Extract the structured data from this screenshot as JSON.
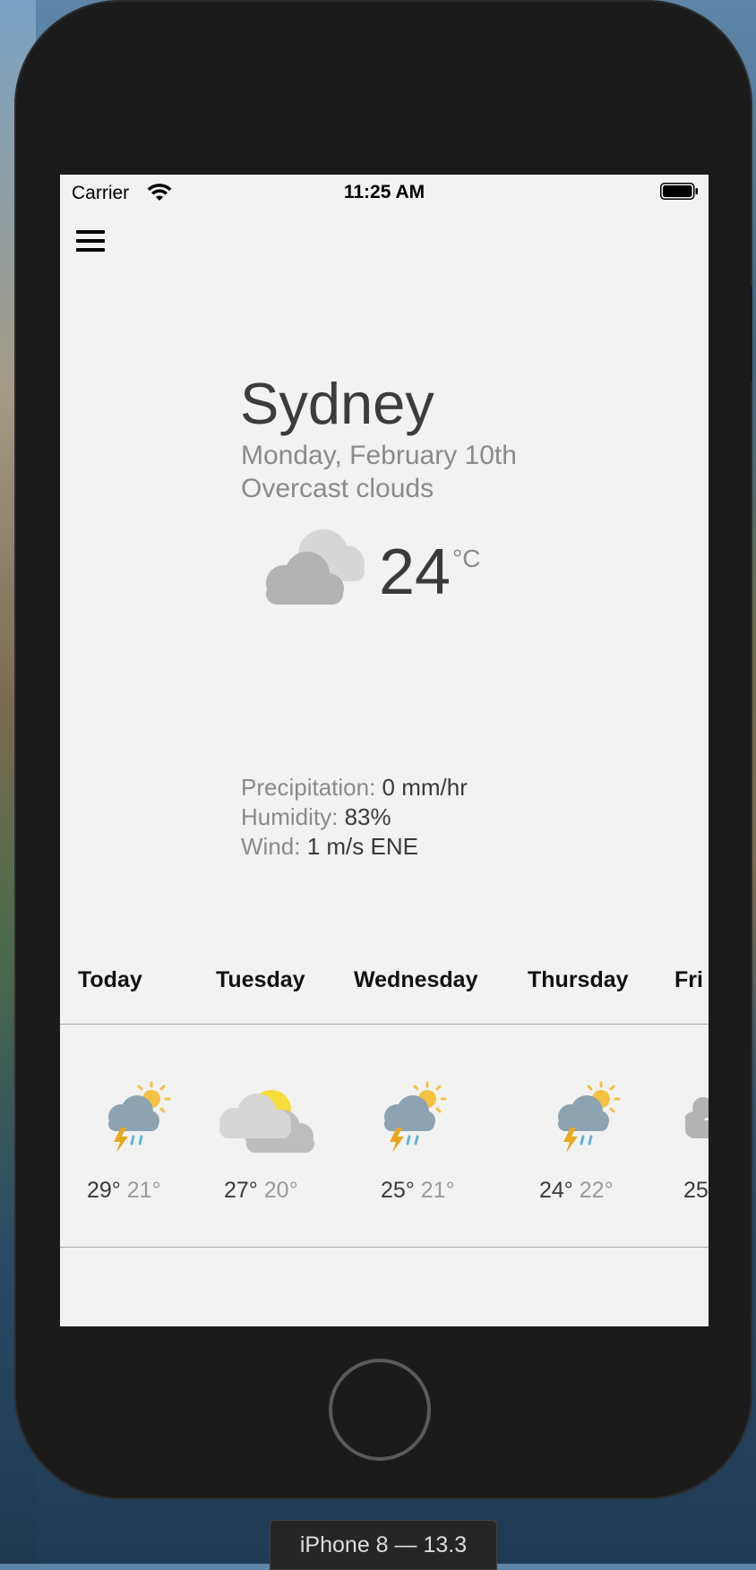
{
  "status_bar": {
    "carrier": "Carrier",
    "time": "11:25 AM"
  },
  "weather": {
    "city": "Sydney",
    "date": "Monday, February 10th",
    "description": "Overcast clouds",
    "icon": "overcast-clouds-icon",
    "temperature": "24",
    "unit": "°C",
    "precipitation_label": "Precipitation:",
    "precipitation_value": "0 mm/hr",
    "humidity_label": "Humidity:",
    "humidity_value": "83%",
    "wind_label": "Wind:",
    "wind_value": "1 m/s ENE"
  },
  "forecast": [
    {
      "day": "Today",
      "icon": "thunderstorm-sun-icon",
      "high": "29°",
      "low": "21°"
    },
    {
      "day": "Tuesday",
      "icon": "partly-cloudy-icon",
      "high": "27°",
      "low": "20°"
    },
    {
      "day": "Wednesday",
      "icon": "thunderstorm-sun-icon",
      "high": "25°",
      "low": "21°"
    },
    {
      "day": "Thursday",
      "icon": "thunderstorm-sun-icon",
      "high": "24°",
      "low": "22°"
    },
    {
      "day": "Fri",
      "icon": "cloud-icon",
      "high": "25"
    }
  ],
  "simulator": {
    "device_label": "iPhone 8 — 13.3"
  }
}
